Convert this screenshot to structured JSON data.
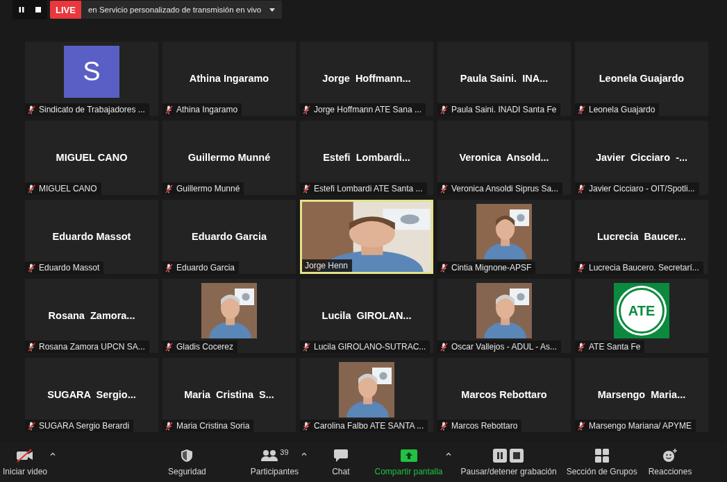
{
  "top_bar": {
    "live_badge": "LIVE",
    "stream_label": "en Servicio personalizado de transmisión en vivo"
  },
  "tiles": [
    {
      "kind": "avatar",
      "initial": "S",
      "label": "Sindicato de Trabajadores ...",
      "muted": true,
      "speaking": false
    },
    {
      "kind": "name",
      "display_name": "Athina Ingaramo",
      "label": "Athina Ingaramo",
      "muted": true,
      "speaking": false
    },
    {
      "kind": "name",
      "display_name": "Jorge  Hoffmann...",
      "label": "Jorge Hoffmann ATE Sana ...",
      "muted": true,
      "speaking": false
    },
    {
      "kind": "name",
      "display_name": "Paula Saini.  INA...",
      "label": "Paula Saini. INADI Santa Fe",
      "muted": true,
      "speaking": false
    },
    {
      "kind": "name",
      "display_name": "Leonela Guajardo",
      "label": "Leonela Guajardo",
      "muted": true,
      "speaking": false
    },
    {
      "kind": "name",
      "display_name": "MIGUEL CANO",
      "label": "MIGUEL CANO",
      "muted": true,
      "speaking": false
    },
    {
      "kind": "name",
      "display_name": "Guillermo Munné",
      "label": "Guillermo Munné",
      "muted": true,
      "speaking": false
    },
    {
      "kind": "name",
      "display_name": "Estefi  Lombardi...",
      "label": "Estefi Lombardi ATE Santa ...",
      "muted": true,
      "speaking": false
    },
    {
      "kind": "name",
      "display_name": "Veronica  Ansold...",
      "label": "Veronica Ansoldi Siprus Sa...",
      "muted": true,
      "speaking": false
    },
    {
      "kind": "name",
      "display_name": "Javier  Cicciaro  -...",
      "label": "Javier Cicciaro - OIT/Spotli...",
      "muted": true,
      "speaking": false
    },
    {
      "kind": "name",
      "display_name": "Eduardo Massot",
      "label": "Eduardo Massot",
      "muted": true,
      "speaking": false
    },
    {
      "kind": "name",
      "display_name": "Eduardo Garcia",
      "label": "Eduardo Garcia",
      "muted": true,
      "speaking": false
    },
    {
      "kind": "video",
      "label": "Jorge Henn",
      "muted": false,
      "speaking": true
    },
    {
      "kind": "picture",
      "label": "Cintia Mignone-APSF",
      "muted": true,
      "speaking": false
    },
    {
      "kind": "name",
      "display_name": "Lucrecia  Baucer...",
      "label": "Lucrecia Baucero. Secretarí...",
      "muted": true,
      "speaking": false
    },
    {
      "kind": "name",
      "display_name": "Rosana  Zamora...",
      "label": "Rosana Zamora UPCN SA...",
      "muted": true,
      "speaking": false
    },
    {
      "kind": "picture",
      "label": "Gladis Cocerez",
      "muted": true,
      "speaking": false
    },
    {
      "kind": "name",
      "display_name": "Lucila  GIROLAN...",
      "label": "Lucila GIROLANO-SUTRAC...",
      "muted": true,
      "speaking": false
    },
    {
      "kind": "picture",
      "label": "Oscar Vallejos - ADUL  - As...",
      "muted": true,
      "speaking": false
    },
    {
      "kind": "logo",
      "logo_text": "ATE",
      "label": "ATE Santa Fe",
      "muted": true,
      "speaking": false
    },
    {
      "kind": "name",
      "display_name": "SUGARA  Sergio...",
      "label": "SUGARA Sergio Berardi",
      "muted": true,
      "speaking": false
    },
    {
      "kind": "name",
      "display_name": "Maria  Cristina  S...",
      "label": "Maria Cristina Soria",
      "muted": true,
      "speaking": false
    },
    {
      "kind": "picture",
      "label": "Carolina Falbo ATE SANTA ...",
      "muted": true,
      "speaking": false
    },
    {
      "kind": "name",
      "display_name": "Marcos Rebottaro",
      "label": "Marcos Rebottaro",
      "muted": true,
      "speaking": false
    },
    {
      "kind": "name",
      "display_name": "Marsengo  Maria...",
      "label": "Marsengo Mariana/ APYME",
      "muted": true,
      "speaking": false
    }
  ],
  "toolbar": [
    {
      "kind": "video",
      "label": "Iniciar video",
      "muted": true
    },
    {
      "kind": "security",
      "label": "Seguridad"
    },
    {
      "kind": "participants",
      "label": "Participantes",
      "count": "39"
    },
    {
      "kind": "chat",
      "label": "Chat"
    },
    {
      "kind": "share",
      "label": "Compartir pantalla"
    },
    {
      "kind": "record",
      "label": "Pausar/detener grabación"
    },
    {
      "kind": "groups",
      "label": "Sección de Grupos"
    },
    {
      "kind": "reactions",
      "label": "Reacciones"
    }
  ]
}
